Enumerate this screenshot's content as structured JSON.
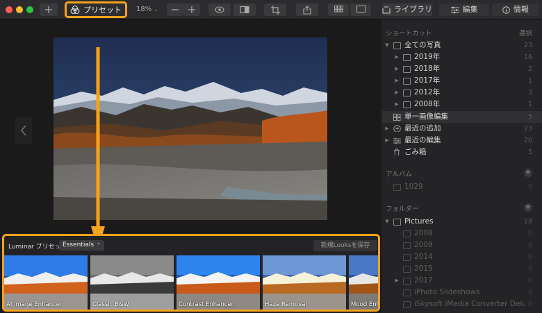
{
  "toolbar": {
    "preset_label": "プリセット",
    "zoom": "18%",
    "tab_library": "ライブラリ",
    "tab_edit": "編集",
    "tab_info": "情報"
  },
  "colors": {
    "accent": "#f7a21b",
    "close": "#ff5f57",
    "minimize": "#febc2e",
    "zoom": "#28c840"
  },
  "sidebar": {
    "shortcuts_header": "ショートカット",
    "select_label": "選択",
    "items": [
      {
        "name": "全ての写真",
        "count": "23"
      },
      {
        "name": "2019年",
        "count": "16"
      },
      {
        "name": "2018年",
        "count": "2"
      },
      {
        "name": "2017年",
        "count": "1"
      },
      {
        "name": "2012年",
        "count": "3"
      },
      {
        "name": "2008年",
        "count": "1"
      },
      {
        "name": "単一画像編集",
        "count": "5"
      },
      {
        "name": "最近の追加",
        "count": "23"
      },
      {
        "name": "最近の編集",
        "count": "20"
      },
      {
        "name": "ごみ箱",
        "count": "5"
      }
    ],
    "albums_header": "アルバム",
    "albums": [
      {
        "name": "1029",
        "count": "0"
      }
    ],
    "folders_header": "フォルダー",
    "folders": [
      {
        "name": "Pictures",
        "count": "18"
      },
      {
        "name": "2008",
        "count": "0"
      },
      {
        "name": "2009",
        "count": "0"
      },
      {
        "name": "2014",
        "count": "0"
      },
      {
        "name": "2015",
        "count": "0"
      },
      {
        "name": "2017",
        "count": "0"
      },
      {
        "name": "iPhoto Slideshows",
        "count": "0"
      },
      {
        "name": "iSkysoft iMedia Converter Delu...",
        "count": "0"
      }
    ]
  },
  "presets": {
    "title": "Luminar プリセット",
    "category": "Essentials",
    "save_looks": "新規Looksを保存",
    "items": [
      {
        "label": "AI Image Enhancer"
      },
      {
        "label": "Classic B&W"
      },
      {
        "label": "Contrast Enhancer"
      },
      {
        "label": "Haze Removal"
      },
      {
        "label": "Mood Enh"
      }
    ]
  }
}
